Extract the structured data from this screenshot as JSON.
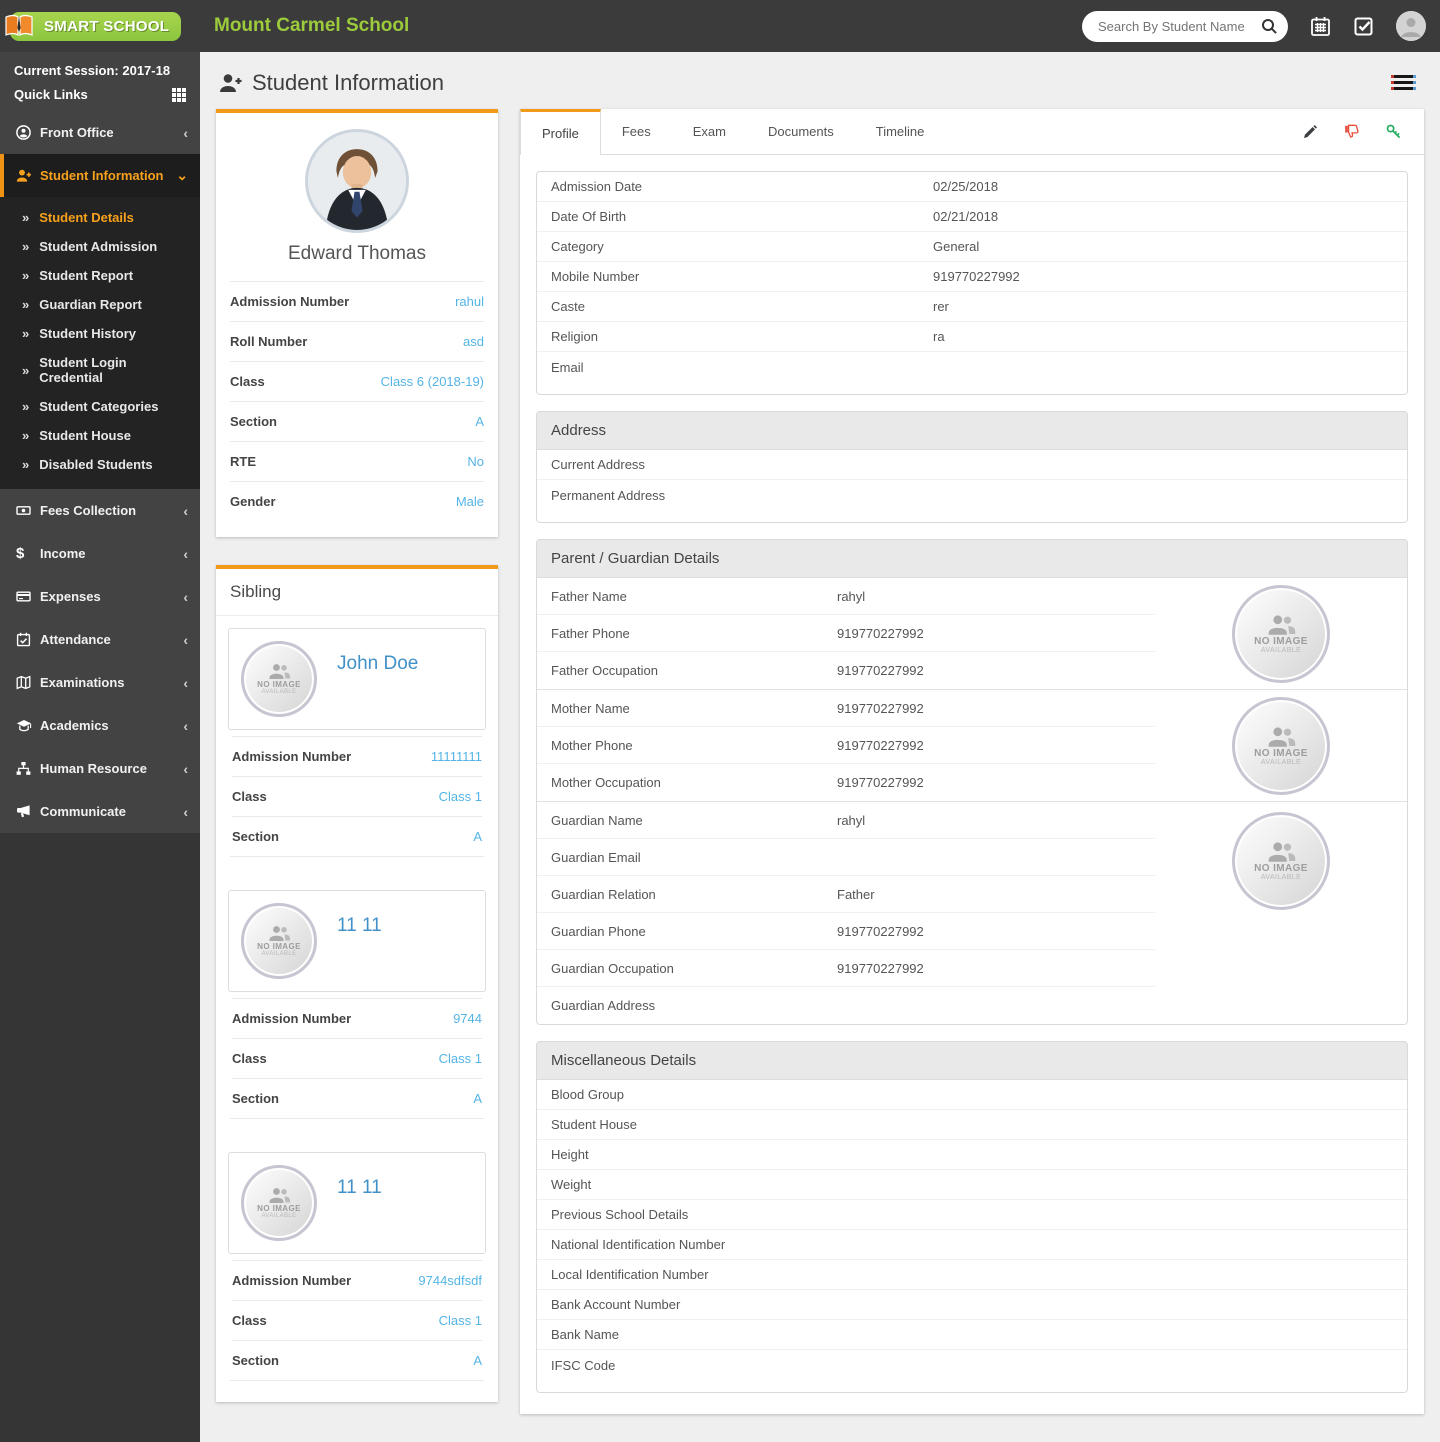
{
  "colors": {
    "accent_orange": "#ef9a18",
    "sidebar_active": "#f7a11c",
    "value_blue": "#54b4e6",
    "link_blue": "#4191c9",
    "brand_green": "#9ccb3c",
    "topbar_bg": "#3b3b3b",
    "sidebar_bg": "#434343"
  },
  "header": {
    "logo_text": "SMART SCHOOL",
    "school_name": "Mount Carmel School",
    "search_placeholder": "Search By Student Name"
  },
  "sidebar": {
    "session": "Current Session: 2017-18",
    "quick_links": "Quick Links",
    "items": [
      {
        "label": "Front Office"
      },
      {
        "label": "Student Information"
      },
      {
        "label": "Fees Collection"
      },
      {
        "label": "Income"
      },
      {
        "label": "Expenses"
      },
      {
        "label": "Attendance"
      },
      {
        "label": "Examinations"
      },
      {
        "label": "Academics"
      },
      {
        "label": "Human Resource"
      },
      {
        "label": "Communicate"
      }
    ],
    "submenu": [
      {
        "label": "Student Details"
      },
      {
        "label": "Student Admission"
      },
      {
        "label": "Student Report"
      },
      {
        "label": "Guardian Report"
      },
      {
        "label": "Student History"
      },
      {
        "label": "Student Login Credential"
      },
      {
        "label": "Student Categories"
      },
      {
        "label": "Student House"
      },
      {
        "label": "Disabled Students"
      }
    ]
  },
  "page": {
    "title": "Student Information"
  },
  "no_image": {
    "line1": "NO IMAGE",
    "line2": "AVAILABLE"
  },
  "student_card": {
    "name": "Edward Thomas",
    "rows": [
      {
        "label": "Admission Number",
        "value": "rahul"
      },
      {
        "label": "Roll Number",
        "value": "asd"
      },
      {
        "label": "Class",
        "value": "Class 6 (2018-19)"
      },
      {
        "label": "Section",
        "value": "A"
      },
      {
        "label": "RTE",
        "value": "No"
      },
      {
        "label": "Gender",
        "value": "Male"
      }
    ]
  },
  "sibling": {
    "title": "Sibling",
    "items": [
      {
        "name": "John Doe",
        "rows": [
          {
            "label": "Admission Number",
            "value": "11111111"
          },
          {
            "label": "Class",
            "value": "Class 1"
          },
          {
            "label": "Section",
            "value": "A"
          }
        ]
      },
      {
        "name": "11 11",
        "rows": [
          {
            "label": "Admission Number",
            "value": "9744"
          },
          {
            "label": "Class",
            "value": "Class 1"
          },
          {
            "label": "Section",
            "value": "A"
          }
        ]
      },
      {
        "name": "11 11",
        "rows": [
          {
            "label": "Admission Number",
            "value": "9744sdfsdf"
          },
          {
            "label": "Class",
            "value": "Class 1"
          },
          {
            "label": "Section",
            "value": "A"
          }
        ]
      }
    ]
  },
  "tabs": {
    "labels": [
      "Profile",
      "Fees",
      "Exam",
      "Documents",
      "Timeline"
    ],
    "active": "Profile"
  },
  "profile": {
    "basic_rows": [
      {
        "label": "Admission Date",
        "value": "02/25/2018"
      },
      {
        "label": "Date Of Birth",
        "value": "02/21/2018"
      },
      {
        "label": "Category",
        "value": "General"
      },
      {
        "label": "Mobile Number",
        "value": "919770227992"
      },
      {
        "label": "Caste",
        "value": "rer"
      },
      {
        "label": "Religion",
        "value": "ra"
      },
      {
        "label": "Email",
        "value": ""
      }
    ],
    "address": {
      "title": "Address",
      "rows": [
        {
          "label": "Current Address",
          "value": ""
        },
        {
          "label": "Permanent Address",
          "value": ""
        }
      ]
    },
    "guardian": {
      "title": "Parent / Guardian Details",
      "father_rows": [
        {
          "label": "Father Name",
          "value": "rahyl"
        },
        {
          "label": "Father Phone",
          "value": "919770227992"
        },
        {
          "label": "Father Occupation",
          "value": "919770227992"
        }
      ],
      "mother_rows": [
        {
          "label": "Mother Name",
          "value": "919770227992"
        },
        {
          "label": "Mother Phone",
          "value": "919770227992"
        },
        {
          "label": "Mother Occupation",
          "value": "919770227992"
        }
      ],
      "guardian_rows": [
        {
          "label": "Guardian Name",
          "value": "rahyl"
        },
        {
          "label": "Guardian Email",
          "value": ""
        },
        {
          "label": "Guardian Relation",
          "value": "Father"
        },
        {
          "label": "Guardian Phone",
          "value": "919770227992"
        },
        {
          "label": "Guardian Occupation",
          "value": "919770227992"
        },
        {
          "label": "Guardian Address",
          "value": ""
        }
      ]
    },
    "misc": {
      "title": "Miscellaneous Details",
      "rows": [
        {
          "label": "Blood Group",
          "value": ""
        },
        {
          "label": "Student House",
          "value": ""
        },
        {
          "label": "Height",
          "value": ""
        },
        {
          "label": "Weight",
          "value": ""
        },
        {
          "label": "Previous School Details",
          "value": ""
        },
        {
          "label": "National Identification Number",
          "value": ""
        },
        {
          "label": "Local Identification Number",
          "value": ""
        },
        {
          "label": "Bank Account Number",
          "value": ""
        },
        {
          "label": "Bank Name",
          "value": ""
        },
        {
          "label": "IFSC Code",
          "value": ""
        }
      ]
    }
  }
}
